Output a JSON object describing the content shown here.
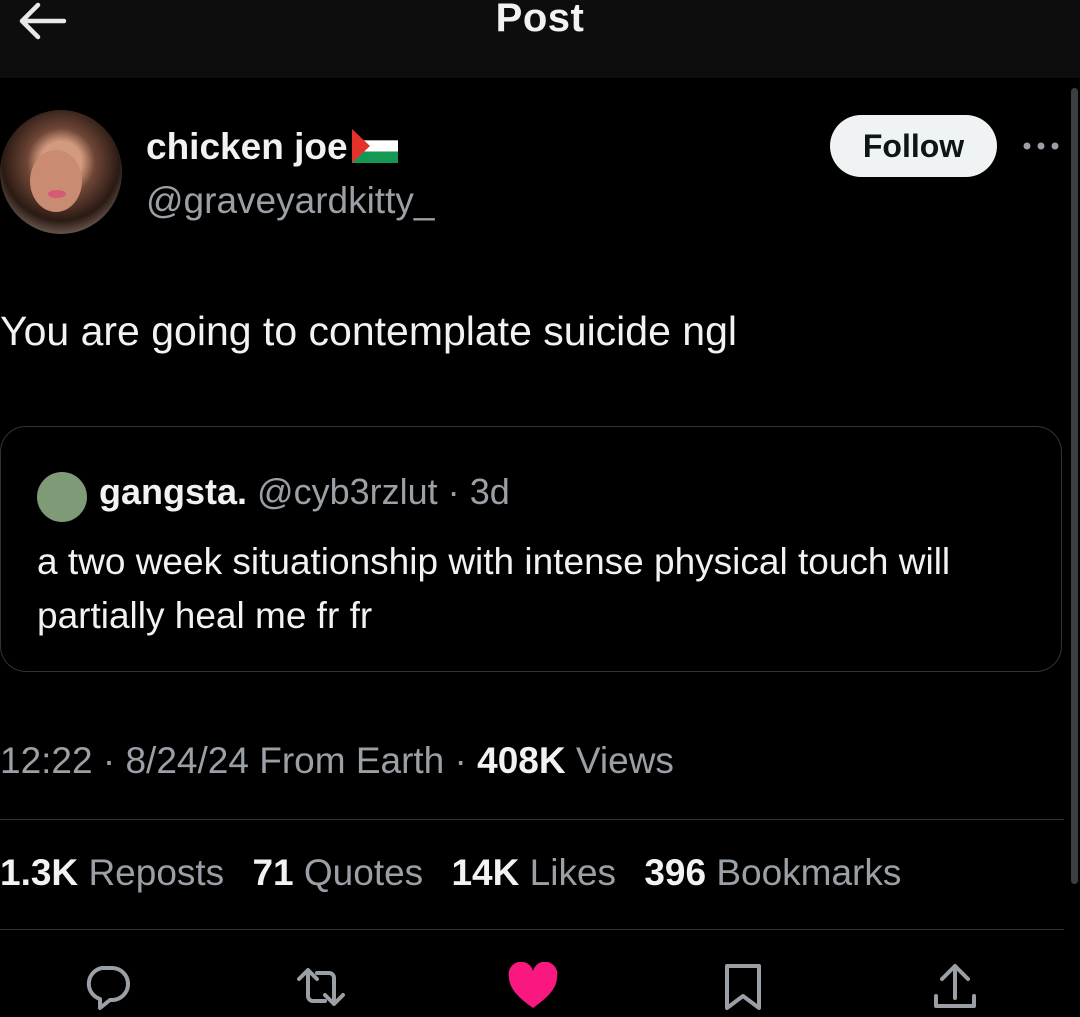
{
  "header": {
    "title": "Post"
  },
  "author": {
    "display_name": "chicken joe",
    "handle": "@graveyardkitty_",
    "follow_label": "Follow"
  },
  "post": {
    "text": "You are going to contemplate suicide ngl"
  },
  "quoted_post": {
    "display_name": "gangsta.",
    "handle": "@cyb3rzlut",
    "separator": "·",
    "age": "3d",
    "text": "a two week situationship with intense physical touch will partially heal me fr fr"
  },
  "meta": {
    "time": "12:22",
    "sep1": " · ",
    "date": "8/24/24",
    "location": "From Earth",
    "sep2": " · ",
    "views_count": "408K",
    "views_label": "Views"
  },
  "stats": [
    {
      "count": "1.3K",
      "label": "Reposts"
    },
    {
      "count": "71",
      "label": "Quotes"
    },
    {
      "count": "14K",
      "label": "Likes"
    },
    {
      "count": "396",
      "label": "Bookmarks"
    }
  ],
  "actions": [
    {
      "icon": "reply-icon"
    },
    {
      "icon": "repost-icon"
    },
    {
      "icon": "heart-icon",
      "color": "#f91880"
    },
    {
      "icon": "bookmark-icon"
    },
    {
      "icon": "share-icon"
    }
  ],
  "colors": {
    "background": "#000000",
    "text_primary": "#e7e9ea",
    "text_secondary": "#9aa0a6",
    "like_active": "#f91880",
    "follow_bg": "#eff3f4",
    "border": "#2f3336"
  }
}
